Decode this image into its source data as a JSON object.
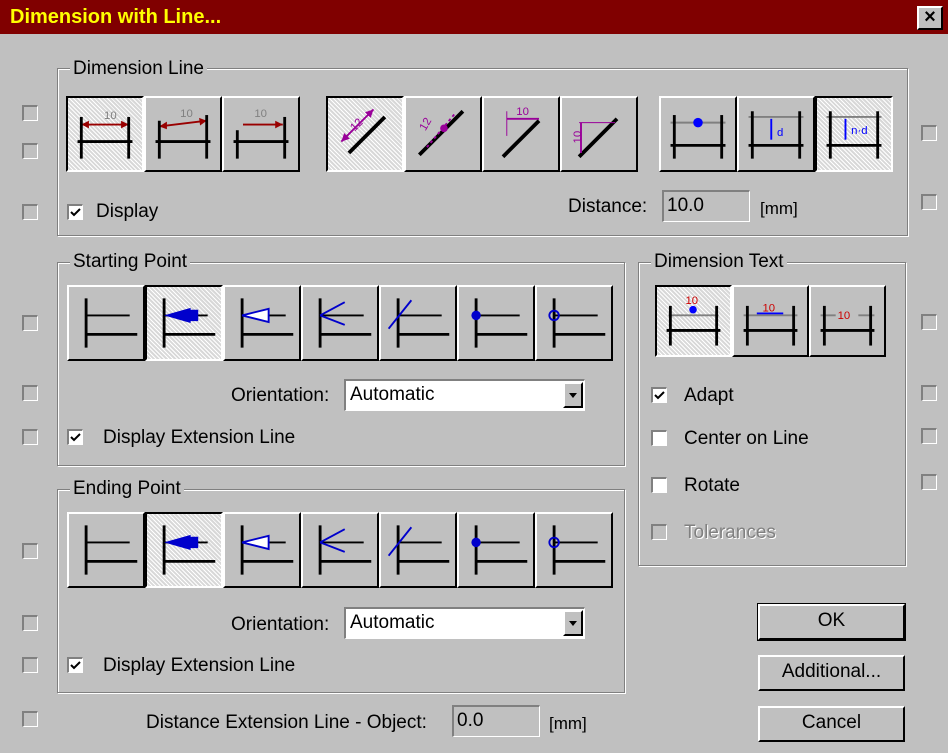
{
  "window": {
    "title": "Dimension with Line...",
    "close": "×"
  },
  "dimension_line": {
    "legend": "Dimension Line",
    "display_label": "Display",
    "display_checked": true,
    "distance_label": "Distance:",
    "distance_value": "10.0",
    "distance_unit": "[mm]",
    "style_buttons": [
      {
        "icon": "dim-line-arrows-icon",
        "pressed": true
      },
      {
        "icon": "dim-line-arrows-skewed-icon",
        "pressed": false
      },
      {
        "icon": "dim-line-single-arrow-icon",
        "pressed": false
      }
    ],
    "direction_buttons": [
      {
        "icon": "dim-aligned-diagonal-icon",
        "pressed": true
      },
      {
        "icon": "dim-aligned-offset-icon",
        "pressed": false
      },
      {
        "icon": "dim-horizontal-diagonal-icon",
        "pressed": false
      },
      {
        "icon": "dim-vertical-diagonal-icon",
        "pressed": false
      }
    ],
    "position_buttons": [
      {
        "icon": "dim-position-point-icon",
        "pressed": false
      },
      {
        "icon": "dim-position-distance-icon",
        "pressed": false
      },
      {
        "icon": "dim-position-n-distance-icon",
        "pressed": true
      }
    ]
  },
  "starting_point": {
    "legend": "Starting Point",
    "orientation_label": "Orientation:",
    "orientation_value": "Automatic",
    "extension_label": "Display Extension Line",
    "extension_checked": true,
    "selected_index": 1,
    "terminators": [
      "none",
      "filled-arrow",
      "open-triangle",
      "open-arrow",
      "slash",
      "dot",
      "circle"
    ]
  },
  "ending_point": {
    "legend": "Ending Point",
    "orientation_label": "Orientation:",
    "orientation_value": "Automatic",
    "extension_label": "Display Extension Line",
    "extension_checked": true,
    "selected_index": 1,
    "terminators": [
      "none",
      "filled-arrow",
      "open-triangle",
      "open-arrow",
      "slash",
      "dot",
      "circle"
    ]
  },
  "dimension_text": {
    "legend": "Dimension Text",
    "text_value": "10",
    "adapt_label": "Adapt",
    "adapt_checked": true,
    "center_label": "Center on Line",
    "center_checked": false,
    "rotate_label": "Rotate",
    "rotate_checked": false,
    "tolerances_label": "Tolerances",
    "tolerances_enabled": false
  },
  "distance_extension": {
    "label": "Distance Extension Line - Object:",
    "value": "0.0",
    "unit": "[mm]"
  },
  "buttons": {
    "ok": "OK",
    "additional": "Additional...",
    "cancel": "Cancel"
  },
  "colors": {
    "title_bg": "#800000",
    "title_fg": "#ffff00",
    "face": "#c0c0c0",
    "dim_red": "#990000",
    "dim_purple": "#990099",
    "dim_blue": "#0000ff",
    "dim_gray": "#808080"
  }
}
